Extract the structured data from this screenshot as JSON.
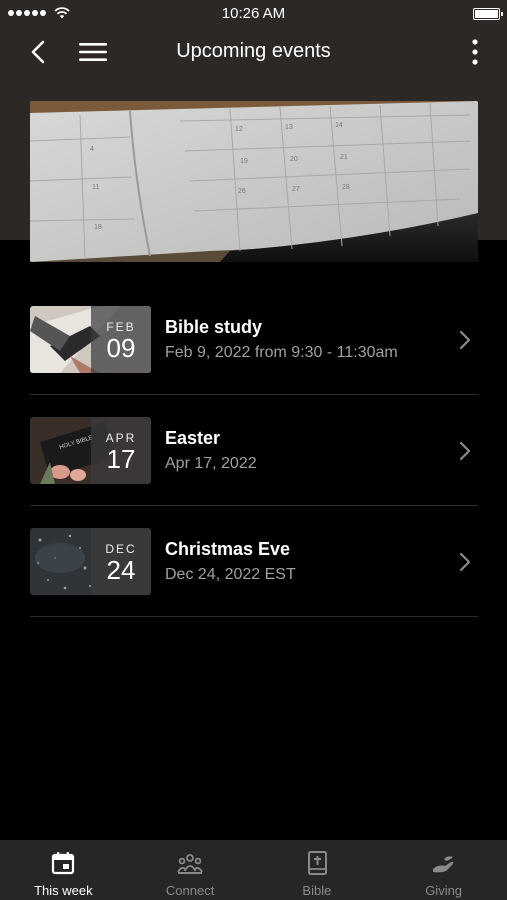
{
  "status_bar": {
    "time": "10:26 AM"
  },
  "header": {
    "title": "Upcoming events"
  },
  "events": [
    {
      "month": "FEB",
      "day": "09",
      "title": "Bible study",
      "subtitle": "Feb 9, 2022 from 9:30 - 11:30am"
    },
    {
      "month": "APR",
      "day": "17",
      "title": "Easter",
      "subtitle": "Apr 17, 2022"
    },
    {
      "month": "DEC",
      "day": "24",
      "title": "Christmas Eve",
      "subtitle": "Dec 24, 2022 EST"
    }
  ],
  "tabs": [
    {
      "label": "This week",
      "icon": "calendar-icon",
      "active": true
    },
    {
      "label": "Connect",
      "icon": "people-icon",
      "active": false
    },
    {
      "label": "Bible",
      "icon": "bible-icon",
      "active": false
    },
    {
      "label": "Giving",
      "icon": "giving-hand-icon",
      "active": false
    }
  ]
}
